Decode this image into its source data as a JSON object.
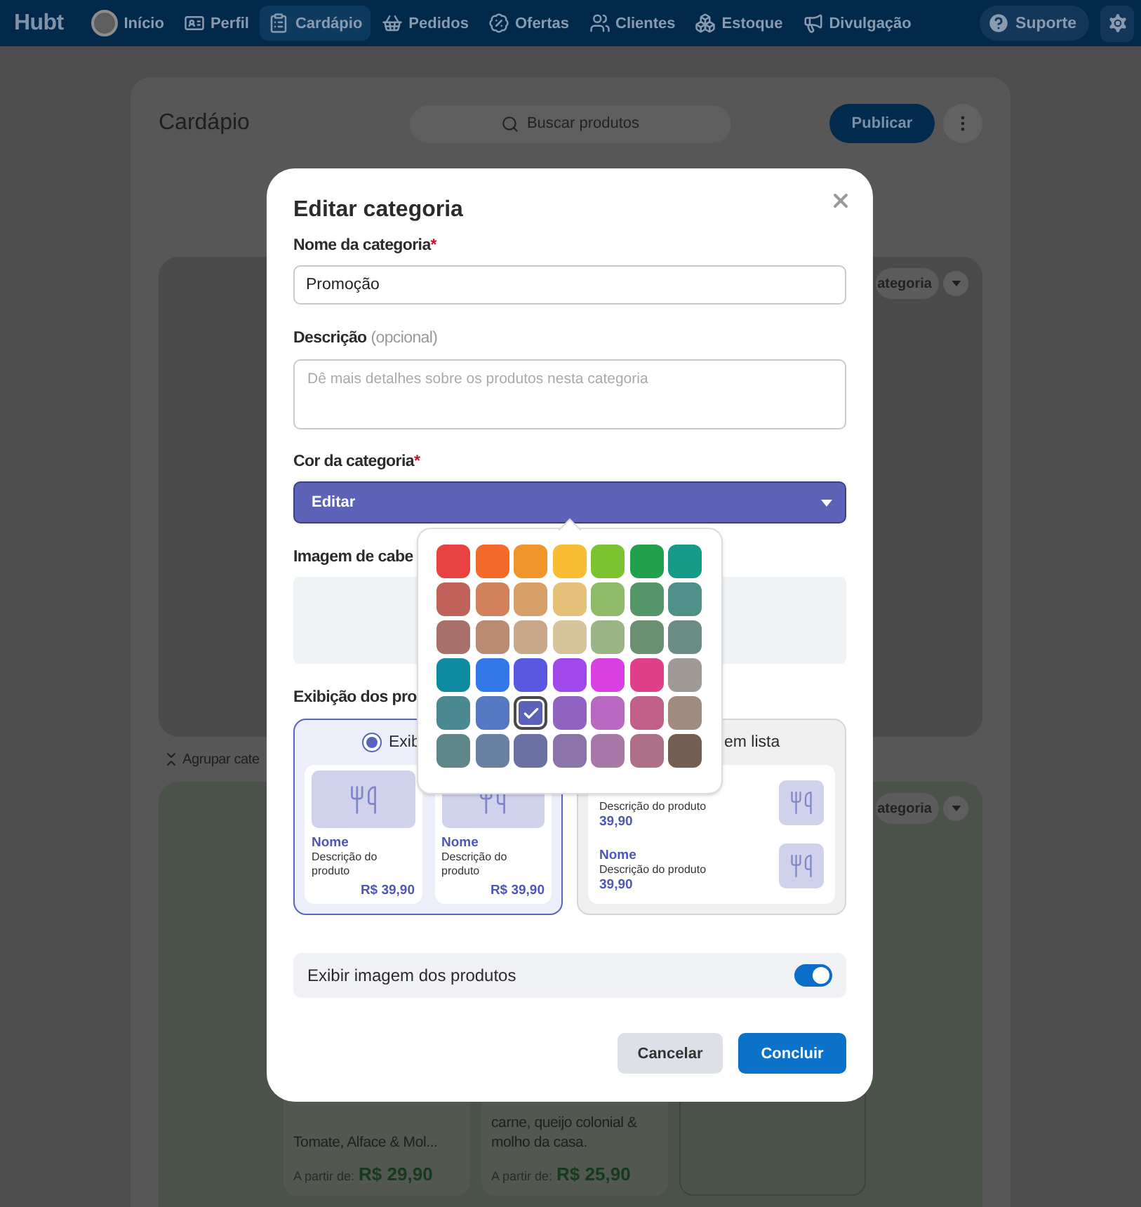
{
  "nav": {
    "logo": "Hubt",
    "items": [
      {
        "label": "Início",
        "selected": false
      },
      {
        "label": "Perfil",
        "selected": false
      },
      {
        "label": "Cardápio",
        "selected": true
      },
      {
        "label": "Pedidos",
        "selected": false
      },
      {
        "label": "Ofertas",
        "selected": false
      },
      {
        "label": "Clientes",
        "selected": false
      },
      {
        "label": "Estoque",
        "selected": false
      },
      {
        "label": "Divulgação",
        "selected": false
      }
    ],
    "support": "Suporte"
  },
  "page": {
    "title": "Cardápio",
    "search": {
      "placeholder": "Buscar produtos"
    },
    "publish": "Publicar",
    "sections": [
      {
        "color": "#4a4a4a",
        "category_button": "ategoria"
      },
      {
        "color": "#4b5249",
        "category_button": "ategoria",
        "products": [
          {
            "kind": "product",
            "description": "Tomate, Alface & Mol...",
            "price_label": "A partir de:",
            "price": "R$ 29,90"
          },
          {
            "kind": "product",
            "description": "carne, queijo colonial & molho da casa.",
            "price_label": "A partir de:",
            "price": "R$ 25,90"
          },
          {
            "kind": "empty"
          }
        ]
      }
    ],
    "group_label": "Agrupar cate"
  },
  "dialog": {
    "title": "Editar categoria",
    "name": {
      "label": "Nome da categoria",
      "required": true,
      "required_mark": "*",
      "value": "Promoção"
    },
    "description": {
      "label": "Descrição",
      "hint": "(opcional)",
      "placeholder": "Dê mais detalhes sobre os produtos nesta categoria"
    },
    "color": {
      "label": "Cor da categoria",
      "required": true,
      "required_mark": "*",
      "value": "Editar"
    },
    "header_image": {
      "label": "Imagem de cabe"
    },
    "display": {
      "label": "Exibição dos pro",
      "options": [
        {
          "kind": "grid",
          "label": "Exib",
          "selected": true,
          "products": [
            {
              "name": "Nome",
              "description": "Descrição do produto",
              "price": "R$ 39,90"
            },
            {
              "name": "Nome",
              "description": "Descrição do produto",
              "price": "R$ 39,90"
            }
          ]
        },
        {
          "kind": "list",
          "label": "em lista",
          "selected": false,
          "products": [
            {
              "description": "Descrição do produto",
              "price": "39,90"
            },
            {
              "name": "Nome",
              "description": "Descrição do produto",
              "price": "39,90"
            }
          ]
        }
      ]
    },
    "show_images": {
      "label": "Exibir imagem dos produtos",
      "on": true
    },
    "buttons": {
      "cancel": "Cancelar",
      "confirm": "Concluir"
    },
    "swatches": [
      {
        "color": "#e84242",
        "selected": false
      },
      {
        "color": "#f36a2b",
        "selected": false
      },
      {
        "color": "#f1952b",
        "selected": false
      },
      {
        "color": "#f8bb32",
        "selected": false
      },
      {
        "color": "#7cc332",
        "selected": false
      },
      {
        "color": "#22a04c",
        "selected": false
      },
      {
        "color": "#179a89",
        "selected": false
      },
      {
        "color": "#c0615a",
        "selected": false
      },
      {
        "color": "#d2815b",
        "selected": false
      },
      {
        "color": "#d8a068",
        "selected": false
      },
      {
        "color": "#e4c078",
        "selected": false
      },
      {
        "color": "#8fbb69",
        "selected": false
      },
      {
        "color": "#559669",
        "selected": false
      },
      {
        "color": "#4f9088",
        "selected": false
      },
      {
        "color": "#a87068",
        "selected": false
      },
      {
        "color": "#bb8a73",
        "selected": false
      },
      {
        "color": "#c8a888",
        "selected": false
      },
      {
        "color": "#d8c49b",
        "selected": false
      },
      {
        "color": "#9ab486",
        "selected": false
      },
      {
        "color": "#6a9071",
        "selected": false
      },
      {
        "color": "#6a8c85",
        "selected": false
      },
      {
        "color": "#0e8ba1",
        "selected": false
      },
      {
        "color": "#3378e9",
        "selected": false
      },
      {
        "color": "#5858e1",
        "selected": false
      },
      {
        "color": "#a048e9",
        "selected": false
      },
      {
        "color": "#d840e1",
        "selected": false
      },
      {
        "color": "#e04089",
        "selected": false
      },
      {
        "color": "#a09a97",
        "selected": false
      },
      {
        "color": "#4b8891",
        "selected": false
      },
      {
        "color": "#5478c1",
        "selected": false
      },
      {
        "color": "#5c62b8",
        "selected": true
      },
      {
        "color": "#9062c1",
        "selected": false
      },
      {
        "color": "#b868c1",
        "selected": false
      },
      {
        "color": "#c06089",
        "selected": false
      },
      {
        "color": "#a08c7f",
        "selected": false
      },
      {
        "color": "#5f8689",
        "selected": false
      },
      {
        "color": "#6880a1",
        "selected": false
      },
      {
        "color": "#6a70a1",
        "selected": false
      },
      {
        "color": "#8a74a9",
        "selected": false
      },
      {
        "color": "#a878a9",
        "selected": false
      },
      {
        "color": "#ae7089",
        "selected": false
      },
      {
        "color": "#735e51",
        "selected": false
      }
    ]
  }
}
